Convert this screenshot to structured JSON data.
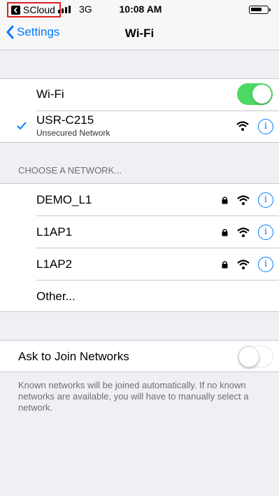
{
  "status_bar": {
    "back_app_label": "SCloud",
    "network": "3G",
    "time": "10:08 AM"
  },
  "nav": {
    "back_label": "Settings",
    "title": "Wi-Fi"
  },
  "wifi": {
    "label": "Wi-Fi",
    "enabled": true,
    "connected_name": "USR-C215",
    "connected_status": "Unsecured Network"
  },
  "networks": {
    "header": "CHOOSE A NETWORK...",
    "items": [
      {
        "name": "DEMO_L1"
      },
      {
        "name": "L1AP1"
      },
      {
        "name": "L1AP2"
      }
    ],
    "other_label": "Other..."
  },
  "ask_to_join": {
    "label": "Ask to Join Networks",
    "enabled": false,
    "footer": "Known networks will be joined automatically. If no known networks are available, you will have to manually select a network."
  },
  "colors": {
    "accent": "#007aff",
    "toggle_on": "#4cd964",
    "highlight_border": "#e02020"
  }
}
